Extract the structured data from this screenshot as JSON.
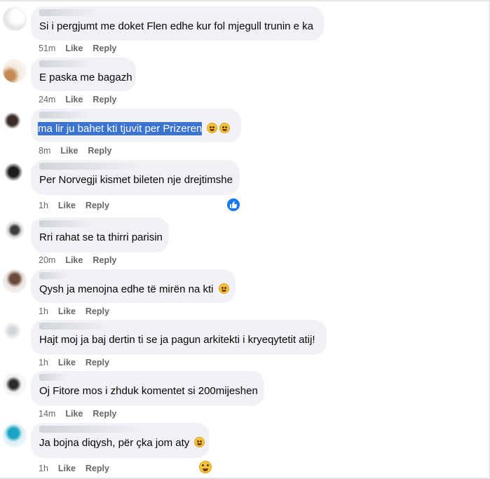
{
  "comments": [
    {
      "text": "Si i pergjumt me doket Flen edhe kur fol mjegull trunin e ka",
      "time": "51m",
      "like": "Like",
      "reply": "Reply"
    },
    {
      "text": "E paska me bagazh",
      "time": "24m",
      "like": "Like",
      "reply": "Reply"
    },
    {
      "text": "ma lir ju bahet kti tjuvit per Prizeren",
      "time": "8m",
      "like": "Like",
      "reply": "Reply"
    },
    {
      "text": "Per Norvegji kismet bileten nje drejtimshe",
      "time": "1h",
      "like": "Like",
      "reply": "Reply"
    },
    {
      "text": "Rri rahat se ta thirri parisin",
      "time": "20m",
      "like": "Like",
      "reply": "Reply"
    },
    {
      "text": "Qysh ja menojna edhe të mirën na kti",
      "time": "1h",
      "like": "Like",
      "reply": "Reply"
    },
    {
      "text": "Hajt moj ja baj dertin ti se ja pagun arkitekti i kryeqytetit atij!",
      "time": "1h",
      "like": "Like",
      "reply": "Reply"
    },
    {
      "text": "Oj Fitore mos i zhduk komentet si 200mijeshen",
      "time": "14m",
      "like": "Like",
      "reply": "Reply"
    },
    {
      "text": "Ja bojna diqysh, për çka jom aty",
      "time": "1h",
      "like": "Like",
      "reply": "Reply"
    }
  ],
  "icons": {
    "like_reaction": "thumbs-up-icon",
    "laugh_emoji": "rofl-emoji-icon",
    "smile_emoji": "grin-emoji-icon"
  },
  "colors": {
    "bubble": "#f0f2f5",
    "selection": "#3b73d1",
    "meta_text": "#65676b",
    "like_blue": "#1877f2"
  }
}
